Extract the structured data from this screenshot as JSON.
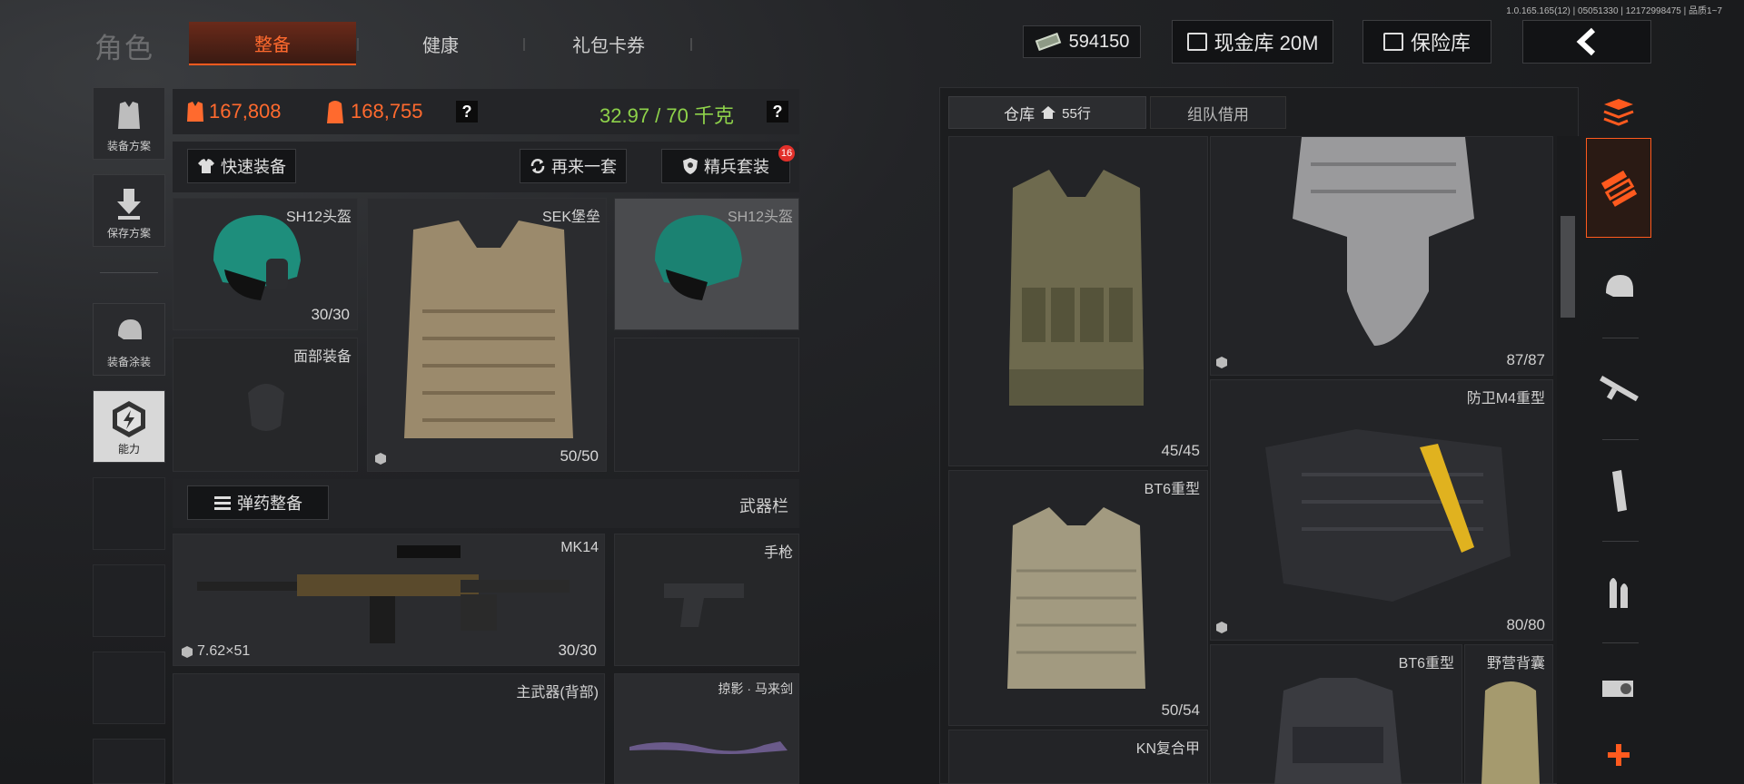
{
  "version": "1.0.165.165(12) | 05051330 | 12172998475 | 品质1~7",
  "title": "角色",
  "tabs": [
    "整备",
    "健康",
    "礼包卡券"
  ],
  "header": {
    "money": "594150",
    "cash_vault": "现金库 20M",
    "safe": "保险库"
  },
  "sidebar": [
    "装备方案",
    "保存方案",
    "装备涂装",
    "能力"
  ],
  "stats": {
    "value1": "167,808",
    "value2": "168,755",
    "weight": "32.97 / 70 千克",
    "help": "?"
  },
  "buttons": {
    "quick_equip": "快速装备",
    "again": "再来一套",
    "elite": "精兵套装",
    "elite_badge": "16",
    "ammo": "弹药整备"
  },
  "gear": {
    "helmet": {
      "label": "SH12头盔",
      "count": "30/30"
    },
    "armor": {
      "label": "SEK堡垒",
      "count": "50/50"
    },
    "helmet_preview": {
      "label": "SH12头盔"
    },
    "face": {
      "label": "面部装备"
    }
  },
  "weapons": {
    "bar_label": "武器栏",
    "primary": {
      "label": "MK14",
      "ammo": "7.62×51",
      "count": "30/30"
    },
    "pistol": {
      "label": "手枪"
    },
    "back": {
      "label": "主武器(背部)"
    },
    "melee": {
      "label": "掠影 · 马来剑"
    }
  },
  "warehouse": {
    "tab1": "仓库",
    "tab1_rows": "55行",
    "tab2": "组队借用",
    "items": [
      {
        "label": "",
        "count": "45/45"
      },
      {
        "label": "",
        "count": "87/87"
      },
      {
        "label": "防卫M4重型",
        "count": "80/80"
      },
      {
        "label": "BT6重型",
        "count": "50/54"
      },
      {
        "label": "BT6重型",
        "count": ""
      },
      {
        "label": "野营背囊",
        "count": ""
      },
      {
        "label": "KN复合甲",
        "count": ""
      }
    ]
  },
  "colors": {
    "accent": "#ff5a1e",
    "weight": "#8ed24a",
    "stat": "#ff6a2e"
  }
}
